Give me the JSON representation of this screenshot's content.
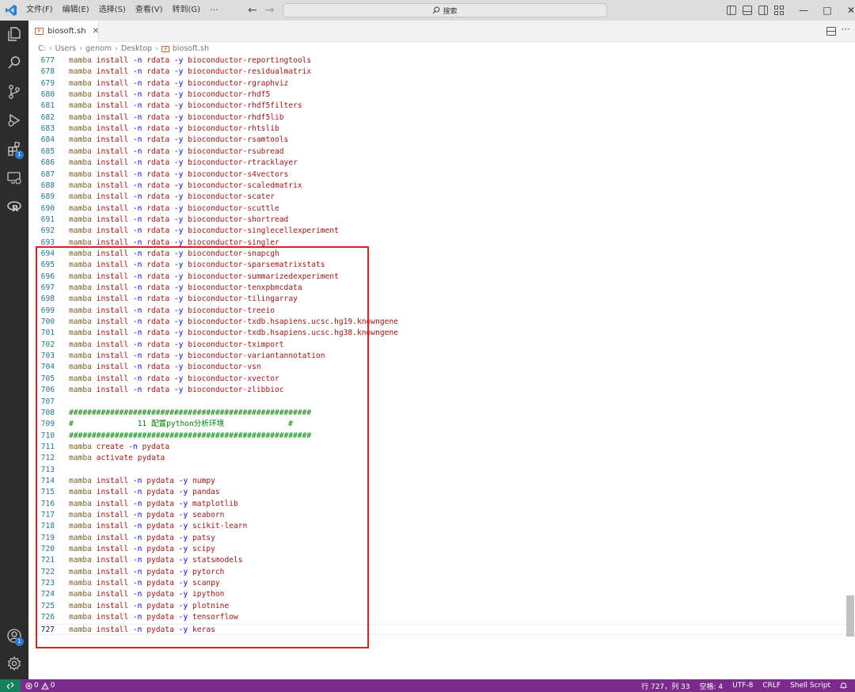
{
  "menu": [
    "文件(F)",
    "编辑(E)",
    "选择(S)",
    "查看(V)",
    "转到(G)"
  ],
  "menu_more": "···",
  "search": {
    "label": "搜索"
  },
  "window_controls": {
    "minimize": "—",
    "maximize": "□",
    "close": "✕"
  },
  "activity_badges": {
    "extensions": "1",
    "accounts": "1"
  },
  "tab": {
    "label": "biosoft.sh",
    "close": "✕"
  },
  "breadcrumb": [
    "C:",
    "Users",
    "genom",
    "Desktop",
    "biosoft.sh"
  ],
  "editor_lines": [
    {
      "n": "677",
      "type": "cmd",
      "env": "rdata",
      "pkg": "bioconductor-reportingtools"
    },
    {
      "n": "678",
      "type": "cmd",
      "env": "rdata",
      "pkg": "bioconductor-residualmatrix"
    },
    {
      "n": "679",
      "type": "cmd",
      "env": "rdata",
      "pkg": "bioconductor-rgraphviz"
    },
    {
      "n": "680",
      "type": "cmd",
      "env": "rdata",
      "pkg": "bioconductor-rhdf5"
    },
    {
      "n": "681",
      "type": "cmd",
      "env": "rdata",
      "pkg": "bioconductor-rhdf5filters"
    },
    {
      "n": "682",
      "type": "cmd",
      "env": "rdata",
      "pkg": "bioconductor-rhdf5lib"
    },
    {
      "n": "683",
      "type": "cmd",
      "env": "rdata",
      "pkg": "bioconductor-rhtslib"
    },
    {
      "n": "684",
      "type": "cmd",
      "env": "rdata",
      "pkg": "bioconductor-rsamtools"
    },
    {
      "n": "685",
      "type": "cmd",
      "env": "rdata",
      "pkg": "bioconductor-rsubread"
    },
    {
      "n": "686",
      "type": "cmd",
      "env": "rdata",
      "pkg": "bioconductor-rtracklayer"
    },
    {
      "n": "687",
      "type": "cmd",
      "env": "rdata",
      "pkg": "bioconductor-s4vectors"
    },
    {
      "n": "688",
      "type": "cmd",
      "env": "rdata",
      "pkg": "bioconductor-scaledmatrix"
    },
    {
      "n": "689",
      "type": "cmd",
      "env": "rdata",
      "pkg": "bioconductor-scater"
    },
    {
      "n": "690",
      "type": "cmd",
      "env": "rdata",
      "pkg": "bioconductor-scuttle"
    },
    {
      "n": "691",
      "type": "cmd",
      "env": "rdata",
      "pkg": "bioconductor-shortread"
    },
    {
      "n": "692",
      "type": "cmd",
      "env": "rdata",
      "pkg": "bioconductor-singlecellexperiment"
    },
    {
      "n": "693",
      "type": "cmd",
      "env": "rdata",
      "pkg": "bioconductor-singler"
    },
    {
      "n": "694",
      "type": "cmd",
      "env": "rdata",
      "pkg": "bioconductor-snapcgh"
    },
    {
      "n": "695",
      "type": "cmd",
      "env": "rdata",
      "pkg": "bioconductor-sparsematrixstats"
    },
    {
      "n": "696",
      "type": "cmd",
      "env": "rdata",
      "pkg": "bioconductor-summarizedexperiment"
    },
    {
      "n": "697",
      "type": "cmd",
      "env": "rdata",
      "pkg": "bioconductor-tenxpbmcdata"
    },
    {
      "n": "698",
      "type": "cmd",
      "env": "rdata",
      "pkg": "bioconductor-tilingarray"
    },
    {
      "n": "699",
      "type": "cmd",
      "env": "rdata",
      "pkg": "bioconductor-treeio"
    },
    {
      "n": "700",
      "type": "cmd",
      "env": "rdata",
      "pkg": "bioconductor-txdb.hsapiens.ucsc.hg19.knowngene"
    },
    {
      "n": "701",
      "type": "cmd",
      "env": "rdata",
      "pkg": "bioconductor-txdb.hsapiens.ucsc.hg38.knowngene"
    },
    {
      "n": "702",
      "type": "cmd",
      "env": "rdata",
      "pkg": "bioconductor-tximport"
    },
    {
      "n": "703",
      "type": "cmd",
      "env": "rdata",
      "pkg": "bioconductor-variantannotation"
    },
    {
      "n": "704",
      "type": "cmd",
      "env": "rdata",
      "pkg": "bioconductor-vsn"
    },
    {
      "n": "705",
      "type": "cmd",
      "env": "rdata",
      "pkg": "bioconductor-xvector"
    },
    {
      "n": "706",
      "type": "cmd",
      "env": "rdata",
      "pkg": "bioconductor-zlibbioc"
    },
    {
      "n": "707",
      "type": "blank"
    },
    {
      "n": "708",
      "type": "comment",
      "text": "#####################################################"
    },
    {
      "n": "709",
      "type": "comment",
      "text": "#              11 配置python分析环境              #"
    },
    {
      "n": "710",
      "type": "comment",
      "text": "#####################################################"
    },
    {
      "n": "711",
      "type": "create",
      "verb": "create",
      "flag": "-n",
      "arg": "pydata"
    },
    {
      "n": "712",
      "type": "activate",
      "verb": "activate",
      "arg": "pydata"
    },
    {
      "n": "713",
      "type": "blank"
    },
    {
      "n": "714",
      "type": "cmd",
      "env": "pydata",
      "pkg": "numpy"
    },
    {
      "n": "715",
      "type": "cmd",
      "env": "pydata",
      "pkg": "pandas"
    },
    {
      "n": "716",
      "type": "cmd",
      "env": "pydata",
      "pkg": "matplotlib"
    },
    {
      "n": "717",
      "type": "cmd",
      "env": "pydata",
      "pkg": "seaborn"
    },
    {
      "n": "718",
      "type": "cmd",
      "env": "pydata",
      "pkg": "scikit-learn"
    },
    {
      "n": "719",
      "type": "cmd",
      "env": "pydata",
      "pkg": "patsy"
    },
    {
      "n": "720",
      "type": "cmd",
      "env": "pydata",
      "pkg": "scipy"
    },
    {
      "n": "721",
      "type": "cmd",
      "env": "pydata",
      "pkg": "statsmodels"
    },
    {
      "n": "722",
      "type": "cmd",
      "env": "pydata",
      "pkg": "pytorch"
    },
    {
      "n": "723",
      "type": "cmd",
      "env": "pydata",
      "pkg": "scanpy"
    },
    {
      "n": "724",
      "type": "cmd",
      "env": "pydata",
      "pkg": "ipython"
    },
    {
      "n": "725",
      "type": "cmd",
      "env": "pydata",
      "pkg": "plotnine"
    },
    {
      "n": "726",
      "type": "cmd",
      "env": "pydata",
      "pkg": "tensorflow"
    },
    {
      "n": "727",
      "type": "cmd",
      "env": "pydata",
      "pkg": "keras",
      "current": true
    }
  ],
  "syntax": {
    "mamba": "mamba",
    "install": "install",
    "n_flag": "-n",
    "y_flag": "-y"
  },
  "statusbar": {
    "remote": "⚡",
    "errors": "0",
    "warnings": "0",
    "position": "行 727，列 33",
    "spaces": "空格: 4",
    "encoding": "UTF-8",
    "eol": "CRLF",
    "language": "Shell Script"
  },
  "colors": {
    "activity_bar": "#2c2c2c",
    "status_bar": "#7a2b8c",
    "remote": "#16825d",
    "highlight": "#e02020",
    "badge": "#2f79d6"
  }
}
